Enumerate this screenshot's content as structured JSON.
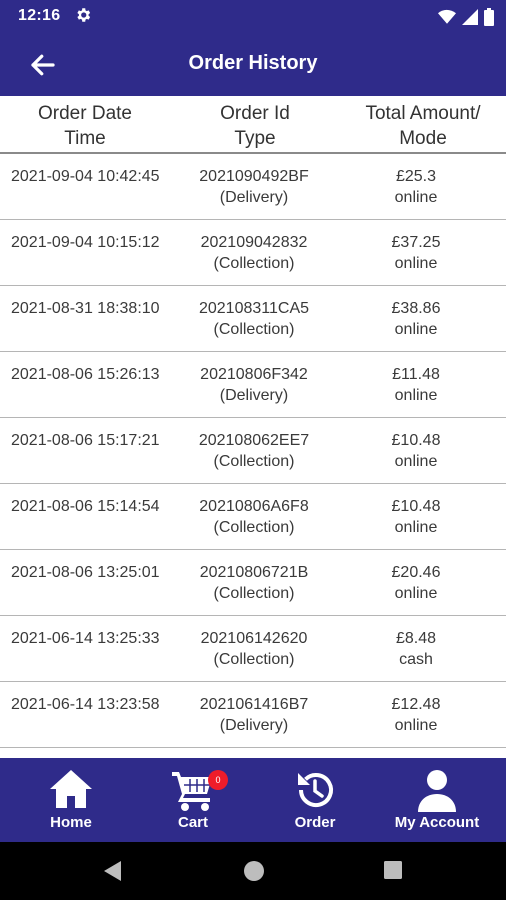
{
  "status_bar": {
    "time": "12:16"
  },
  "header": {
    "title": "Order History"
  },
  "table": {
    "columns": [
      {
        "line1": "Order Date",
        "line2": "Time"
      },
      {
        "line1": "Order Id",
        "line2": "Type"
      },
      {
        "line1": "Total Amount/",
        "line2": "Mode"
      }
    ],
    "rows": [
      {
        "datetime": "2021-09-04 10:42:45",
        "order_id": "2021090492BF",
        "type": "(Delivery)",
        "amount": "£25.3",
        "mode": "online"
      },
      {
        "datetime": "2021-09-04 10:15:12",
        "order_id": "202109042832",
        "type": "(Collection)",
        "amount": "£37.25",
        "mode": "online"
      },
      {
        "datetime": "2021-08-31 18:38:10",
        "order_id": "202108311CA5",
        "type": "(Collection)",
        "amount": "£38.86",
        "mode": "online"
      },
      {
        "datetime": "2021-08-06 15:26:13",
        "order_id": "20210806F342",
        "type": "(Delivery)",
        "amount": "£11.48",
        "mode": "online"
      },
      {
        "datetime": "2021-08-06 15:17:21",
        "order_id": "202108062EE7",
        "type": "(Collection)",
        "amount": "£10.48",
        "mode": "online"
      },
      {
        "datetime": "2021-08-06 15:14:54",
        "order_id": "20210806A6F8",
        "type": "(Collection)",
        "amount": "£10.48",
        "mode": "online"
      },
      {
        "datetime": "2021-08-06 13:25:01",
        "order_id": "20210806721B",
        "type": "(Collection)",
        "amount": "£20.46",
        "mode": "online"
      },
      {
        "datetime": "2021-06-14 13:25:33",
        "order_id": "202106142620",
        "type": "(Collection)",
        "amount": "£8.48",
        "mode": "cash"
      },
      {
        "datetime": "2021-06-14 13:23:58",
        "order_id": "2021061416B7",
        "type": "(Delivery)",
        "amount": "£12.48",
        "mode": "online"
      },
      {
        "datetime": "",
        "order_id": "",
        "type": "",
        "amount": "",
        "mode": ""
      }
    ]
  },
  "bottom_nav": {
    "items": [
      {
        "label": "Home",
        "icon": "home-icon"
      },
      {
        "label": "Cart",
        "icon": "cart-icon",
        "badge": "0"
      },
      {
        "label": "Order",
        "icon": "history-icon"
      },
      {
        "label": "My Account",
        "icon": "account-icon"
      }
    ]
  },
  "colors": {
    "primary": "#2f2b8a",
    "badge": "#ee1c2a"
  }
}
